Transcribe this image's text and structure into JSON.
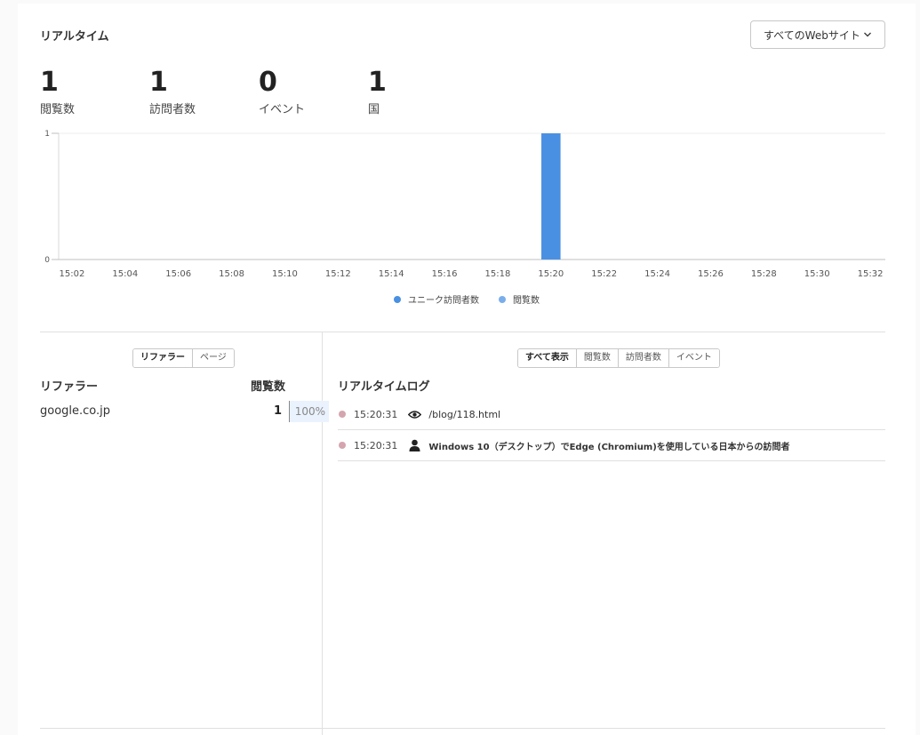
{
  "header": {
    "title": "リアルタイム"
  },
  "website_select": {
    "value": "すべてのWebサイト"
  },
  "metrics": [
    {
      "value": "1",
      "label": "閲覧数"
    },
    {
      "value": "1",
      "label": "訪問者数"
    },
    {
      "value": "0",
      "label": "イベント"
    },
    {
      "value": "1",
      "label": "国"
    }
  ],
  "chart_data": {
    "type": "bar",
    "categories": [
      "15:02",
      "15:03",
      "15:04",
      "15:05",
      "15:06",
      "15:07",
      "15:08",
      "15:09",
      "15:10",
      "15:11",
      "15:12",
      "15:13",
      "15:14",
      "15:15",
      "15:16",
      "15:17",
      "15:18",
      "15:19",
      "15:20",
      "15:21",
      "15:22",
      "15:23",
      "15:24",
      "15:25",
      "15:26",
      "15:27",
      "15:28",
      "15:29",
      "15:30",
      "15:31",
      "15:32"
    ],
    "tick_labels": [
      "15:02",
      "15:04",
      "15:06",
      "15:08",
      "15:10",
      "15:12",
      "15:14",
      "15:16",
      "15:18",
      "15:20",
      "15:22",
      "15:24",
      "15:26",
      "15:28",
      "15:30",
      "15:32"
    ],
    "series": [
      {
        "name": "ユニーク訪問者数",
        "color": "#4a90e2",
        "values": [
          0,
          0,
          0,
          0,
          0,
          0,
          0,
          0,
          0,
          0,
          0,
          0,
          0,
          0,
          0,
          0,
          0,
          0,
          1,
          0,
          0,
          0,
          0,
          0,
          0,
          0,
          0,
          0,
          0,
          0,
          0
        ]
      },
      {
        "name": "閲覧数",
        "color": "#7aaeea",
        "values": [
          0,
          0,
          0,
          0,
          0,
          0,
          0,
          0,
          0,
          0,
          0,
          0,
          0,
          0,
          0,
          0,
          0,
          0,
          1,
          0,
          0,
          0,
          0,
          0,
          0,
          0,
          0,
          0,
          0,
          0,
          0
        ]
      }
    ],
    "ylim": [
      0,
      1
    ],
    "y_ticks": [
      "0",
      "1"
    ],
    "grid": true,
    "legend": "bottom"
  },
  "referrers": {
    "tabs": [
      "リファラー",
      "ページ"
    ],
    "active_tab": 0,
    "col_name": "リファラー",
    "col_count": "閲覧数",
    "rows": [
      {
        "name": "google.co.jp",
        "count": "1",
        "percent": "100%"
      }
    ]
  },
  "log": {
    "filters": [
      "すべて表示",
      "閲覧数",
      "訪問者数",
      "イベント"
    ],
    "active_filter": 0,
    "title": "リアルタイムログ",
    "entries": [
      {
        "time": "15:20:31",
        "icon": "eye-icon",
        "text": "/blog/118.html",
        "bold": false
      },
      {
        "time": "15:20:31",
        "icon": "user-icon",
        "text": "Windows 10（デスクトップ）でEdge (Chromium)を使用している日本からの訪問者",
        "bold": true
      }
    ]
  }
}
